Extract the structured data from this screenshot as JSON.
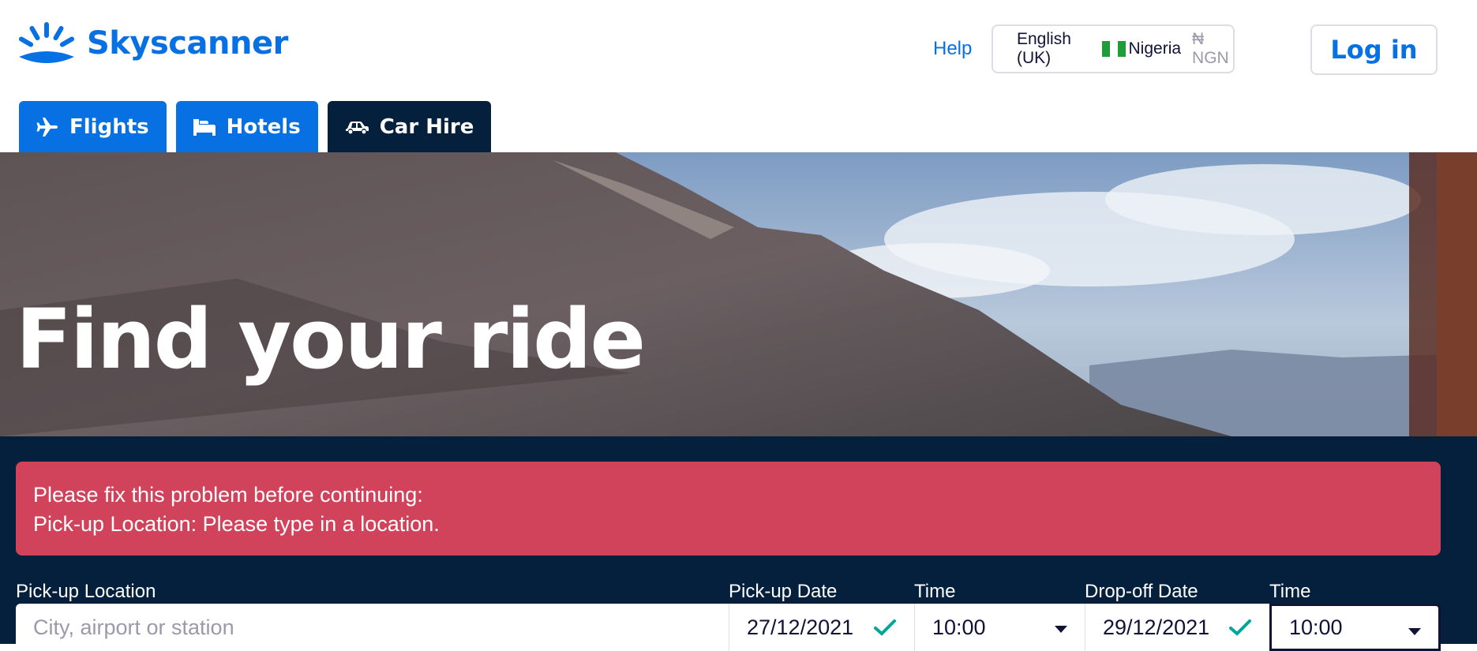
{
  "header": {
    "logo_text": "Skyscanner",
    "help_label": "Help",
    "language": "English (UK)",
    "country": "Nigeria",
    "currency": "₦ NGN",
    "login_label": "Log in"
  },
  "tabs": [
    {
      "label": "Flights",
      "icon": "plane-icon"
    },
    {
      "label": "Hotels",
      "icon": "bed-icon"
    },
    {
      "label": "Car Hire",
      "icon": "car-icon",
      "active": true
    }
  ],
  "hero": {
    "title": "Find your ride"
  },
  "error": {
    "line1": "Please fix this problem before continuing:",
    "line2": "Pick-up Location: Please type in a location."
  },
  "form": {
    "pickup_location_label": "Pick-up Location",
    "pickup_location_placeholder": "City, airport or station",
    "pickup_date_label": "Pick-up Date",
    "pickup_date": "27/12/2021",
    "pickup_time_label": "Time",
    "pickup_time": "10:00",
    "dropoff_date_label": "Drop-off Date",
    "dropoff_date": "29/12/2021",
    "dropoff_time_label": "Time",
    "dropoff_time": "10:00"
  },
  "colors": {
    "brand_blue": "#0770e3",
    "navy": "#05203c",
    "error_red": "#d1435b",
    "check_green": "#00a698",
    "nigeria_green": "#1f9d3a"
  }
}
